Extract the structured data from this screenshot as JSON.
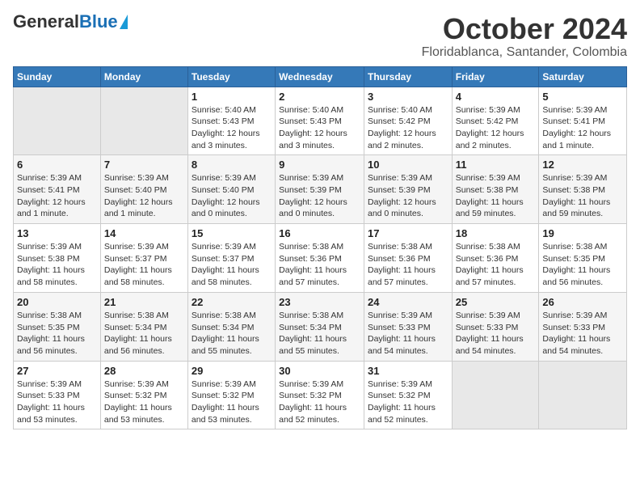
{
  "logo": {
    "part1": "General",
    "part2": "Blue"
  },
  "title": "October 2024",
  "subtitle": "Floridablanca, Santander, Colombia",
  "headers": [
    "Sunday",
    "Monday",
    "Tuesday",
    "Wednesday",
    "Thursday",
    "Friday",
    "Saturday"
  ],
  "weeks": [
    [
      {
        "day": "",
        "info": ""
      },
      {
        "day": "",
        "info": ""
      },
      {
        "day": "1",
        "info": "Sunrise: 5:40 AM\nSunset: 5:43 PM\nDaylight: 12 hours\nand 3 minutes."
      },
      {
        "day": "2",
        "info": "Sunrise: 5:40 AM\nSunset: 5:43 PM\nDaylight: 12 hours\nand 3 minutes."
      },
      {
        "day": "3",
        "info": "Sunrise: 5:40 AM\nSunset: 5:42 PM\nDaylight: 12 hours\nand 2 minutes."
      },
      {
        "day": "4",
        "info": "Sunrise: 5:39 AM\nSunset: 5:42 PM\nDaylight: 12 hours\nand 2 minutes."
      },
      {
        "day": "5",
        "info": "Sunrise: 5:39 AM\nSunset: 5:41 PM\nDaylight: 12 hours\nand 1 minute."
      }
    ],
    [
      {
        "day": "6",
        "info": "Sunrise: 5:39 AM\nSunset: 5:41 PM\nDaylight: 12 hours\nand 1 minute."
      },
      {
        "day": "7",
        "info": "Sunrise: 5:39 AM\nSunset: 5:40 PM\nDaylight: 12 hours\nand 1 minute."
      },
      {
        "day": "8",
        "info": "Sunrise: 5:39 AM\nSunset: 5:40 PM\nDaylight: 12 hours\nand 0 minutes."
      },
      {
        "day": "9",
        "info": "Sunrise: 5:39 AM\nSunset: 5:39 PM\nDaylight: 12 hours\nand 0 minutes."
      },
      {
        "day": "10",
        "info": "Sunrise: 5:39 AM\nSunset: 5:39 PM\nDaylight: 12 hours\nand 0 minutes."
      },
      {
        "day": "11",
        "info": "Sunrise: 5:39 AM\nSunset: 5:38 PM\nDaylight: 11 hours\nand 59 minutes."
      },
      {
        "day": "12",
        "info": "Sunrise: 5:39 AM\nSunset: 5:38 PM\nDaylight: 11 hours\nand 59 minutes."
      }
    ],
    [
      {
        "day": "13",
        "info": "Sunrise: 5:39 AM\nSunset: 5:38 PM\nDaylight: 11 hours\nand 58 minutes."
      },
      {
        "day": "14",
        "info": "Sunrise: 5:39 AM\nSunset: 5:37 PM\nDaylight: 11 hours\nand 58 minutes."
      },
      {
        "day": "15",
        "info": "Sunrise: 5:39 AM\nSunset: 5:37 PM\nDaylight: 11 hours\nand 58 minutes."
      },
      {
        "day": "16",
        "info": "Sunrise: 5:38 AM\nSunset: 5:36 PM\nDaylight: 11 hours\nand 57 minutes."
      },
      {
        "day": "17",
        "info": "Sunrise: 5:38 AM\nSunset: 5:36 PM\nDaylight: 11 hours\nand 57 minutes."
      },
      {
        "day": "18",
        "info": "Sunrise: 5:38 AM\nSunset: 5:36 PM\nDaylight: 11 hours\nand 57 minutes."
      },
      {
        "day": "19",
        "info": "Sunrise: 5:38 AM\nSunset: 5:35 PM\nDaylight: 11 hours\nand 56 minutes."
      }
    ],
    [
      {
        "day": "20",
        "info": "Sunrise: 5:38 AM\nSunset: 5:35 PM\nDaylight: 11 hours\nand 56 minutes."
      },
      {
        "day": "21",
        "info": "Sunrise: 5:38 AM\nSunset: 5:34 PM\nDaylight: 11 hours\nand 56 minutes."
      },
      {
        "day": "22",
        "info": "Sunrise: 5:38 AM\nSunset: 5:34 PM\nDaylight: 11 hours\nand 55 minutes."
      },
      {
        "day": "23",
        "info": "Sunrise: 5:38 AM\nSunset: 5:34 PM\nDaylight: 11 hours\nand 55 minutes."
      },
      {
        "day": "24",
        "info": "Sunrise: 5:39 AM\nSunset: 5:33 PM\nDaylight: 11 hours\nand 54 minutes."
      },
      {
        "day": "25",
        "info": "Sunrise: 5:39 AM\nSunset: 5:33 PM\nDaylight: 11 hours\nand 54 minutes."
      },
      {
        "day": "26",
        "info": "Sunrise: 5:39 AM\nSunset: 5:33 PM\nDaylight: 11 hours\nand 54 minutes."
      }
    ],
    [
      {
        "day": "27",
        "info": "Sunrise: 5:39 AM\nSunset: 5:33 PM\nDaylight: 11 hours\nand 53 minutes."
      },
      {
        "day": "28",
        "info": "Sunrise: 5:39 AM\nSunset: 5:32 PM\nDaylight: 11 hours\nand 53 minutes."
      },
      {
        "day": "29",
        "info": "Sunrise: 5:39 AM\nSunset: 5:32 PM\nDaylight: 11 hours\nand 53 minutes."
      },
      {
        "day": "30",
        "info": "Sunrise: 5:39 AM\nSunset: 5:32 PM\nDaylight: 11 hours\nand 52 minutes."
      },
      {
        "day": "31",
        "info": "Sunrise: 5:39 AM\nSunset: 5:32 PM\nDaylight: 11 hours\nand 52 minutes."
      },
      {
        "day": "",
        "info": ""
      },
      {
        "day": "",
        "info": ""
      }
    ]
  ]
}
